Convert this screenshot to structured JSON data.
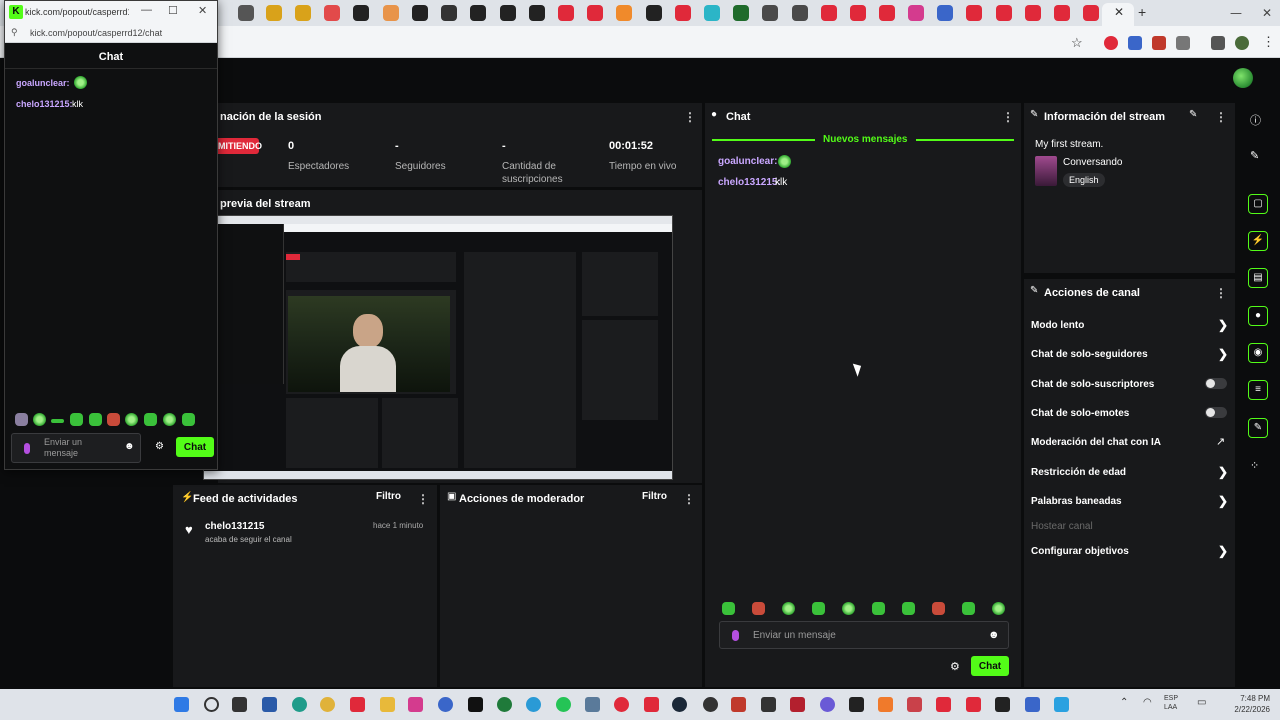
{
  "browser": {
    "popout_url": "kick.com/popout/casperrd12/chat",
    "popout_title": "kick.com/popout/casperrd1..."
  },
  "popout_chat": {
    "title": "Chat",
    "messages": [
      {
        "user": "goaluncIear:",
        "text": "",
        "has_emote": true
      },
      {
        "user": "chelo131215:",
        "text": "klk",
        "has_emote": false
      }
    ],
    "input_placeholder": "Enviar un mensaje",
    "send_label": "Chat"
  },
  "session": {
    "title": "nación de la sesión",
    "live_badge": "MITIENDO",
    "stats": [
      {
        "value": "0",
        "label": "Espectadores"
      },
      {
        "value": "-",
        "label": "Seguidores"
      },
      {
        "value": "-",
        "label": "Cantidad de suscripciones"
      },
      {
        "value": "00:01:52",
        "label": "Tiempo en vivo"
      }
    ]
  },
  "preview": {
    "title": "previa del stream"
  },
  "activity": {
    "title": "Feed de actividades",
    "filter_label": "Filtro",
    "items": [
      {
        "user": "chelo131215",
        "time": "hace 1 minuto",
        "text": "acaba de seguir el canal"
      }
    ]
  },
  "mod_actions": {
    "title": "Acciones de moderador",
    "filter_label": "Filtro"
  },
  "chat": {
    "title": "Chat",
    "new_messages": "Nuevos mensajes",
    "messages": [
      {
        "user": "goaluncIear:",
        "text": "",
        "has_emote": true
      },
      {
        "user": "chelo131215:",
        "text": "klk",
        "has_emote": false
      }
    ],
    "input_placeholder": "Enviar un mensaje",
    "send_label": "Chat"
  },
  "stream_info": {
    "title": "Información del stream",
    "stream_title": "My first stream.",
    "category": "Conversando",
    "language": "English"
  },
  "channel_actions": {
    "title": "Acciones de canal",
    "items": [
      {
        "label": "Modo lento",
        "control": "chevron"
      },
      {
        "label": "Chat de solo-seguidores",
        "control": "chevron"
      },
      {
        "label": "Chat de solo-suscriptores",
        "control": "toggle"
      },
      {
        "label": "Chat de solo-emotes",
        "control": "toggle"
      },
      {
        "label": "Moderación del chat con IA",
        "control": "external"
      },
      {
        "label": "Restricción de edad",
        "control": "chevron"
      },
      {
        "label": "Palabras baneadas",
        "control": "chevron"
      },
      {
        "label": "Hostear canal",
        "control": "disabled"
      },
      {
        "label": "Configurar objetivos",
        "control": "chevron"
      }
    ]
  },
  "colors": {
    "accent": "#53fc18",
    "panel": "#18191b",
    "username": "#c9a7ff"
  },
  "taskbar": {
    "time": "7:48 PM",
    "date": "2/22/2026",
    "lang": "ESP",
    "region": "LAA"
  }
}
